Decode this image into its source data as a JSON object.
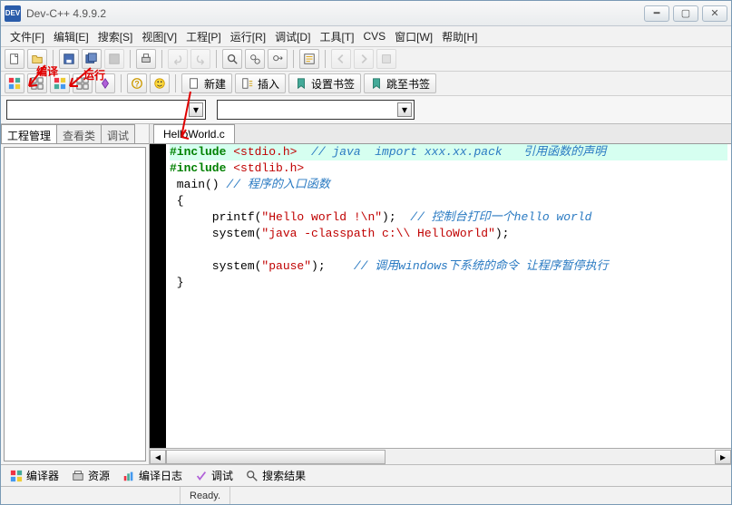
{
  "window": {
    "title": "Dev-C++ 4.9.9.2"
  },
  "menu": {
    "items": [
      {
        "label": "文件[F]"
      },
      {
        "label": "编辑[E]"
      },
      {
        "label": "搜索[S]"
      },
      {
        "label": "视图[V]"
      },
      {
        "label": "工程[P]"
      },
      {
        "label": "运行[R]"
      },
      {
        "label": "调试[D]"
      },
      {
        "label": "工具[T]"
      },
      {
        "label": "CVS"
      },
      {
        "label": "窗口[W]"
      },
      {
        "label": "帮助[H]"
      }
    ]
  },
  "toolbar2": {
    "new": "新建",
    "insert": "插入",
    "set_bookmark": "设置书签",
    "goto_bookmark": "跳至书签"
  },
  "left_tabs": {
    "project": "工程管理",
    "classes": "查看类",
    "debug": "调试"
  },
  "file_tab": "HelloWorld.c",
  "code": {
    "l1_kw": "#include ",
    "l1_hdr": "<stdio.h>",
    "l1_cmt": "  // java  import xxx.xx.pack   引用函数的声明",
    "l2_kw": "#include ",
    "l2_hdr": "<stdlib.h>",
    "l3_a": " main() ",
    "l3_cmt": "// 程序的入口函数",
    "l4": " {",
    "l5_a": "      printf(",
    "l5_str": "\"Hello world !\\n\"",
    "l5_b": ");  ",
    "l5_cmt": "// 控制台打印一个hello world",
    "l6_a": "      system(",
    "l6_str": "\"java -classpath c:\\\\ HelloWorld\"",
    "l6_b": ");",
    "l7_a": "      system(",
    "l7_str": "\"pause\"",
    "l7_b": ");    ",
    "l7_cmt": "// 调用windows下系统的命令 让程序暂停执行",
    "l8": " }"
  },
  "bottom_tabs": {
    "compiler": "编译器",
    "resources": "资源",
    "compile_log": "编译日志",
    "debug": "调试",
    "search_results": "搜索结果"
  },
  "status": {
    "ready": "Ready."
  },
  "annotations": {
    "compile": "编译",
    "run": "运行"
  }
}
